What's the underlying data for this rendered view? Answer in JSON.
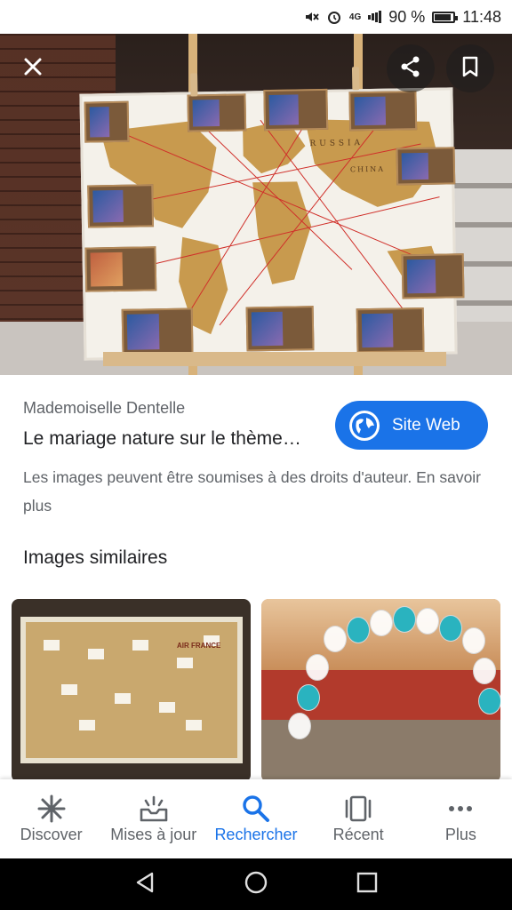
{
  "status_bar": {
    "network": "4G",
    "battery": "90 %",
    "time": "11:48"
  },
  "hero": {
    "icons": [
      "close-icon",
      "share-icon",
      "bookmark-icon"
    ],
    "map_labels": [
      "RUSSIA",
      "CHINA"
    ]
  },
  "result": {
    "source": "Mademoiselle Dentelle",
    "title": "Le mariage nature sur le thème…",
    "site_button": "Site Web",
    "copyright": "Les images peuvent être soumises à des droits d'auteur. En savoir plus"
  },
  "similar": {
    "heading": "Images similaires",
    "thumb1_label": "AIR FRANCE"
  },
  "bottom_nav": {
    "items": [
      {
        "label": "Discover",
        "icon": "asterisk-icon"
      },
      {
        "label": "Mises à jour",
        "icon": "updates-icon"
      },
      {
        "label": "Rechercher",
        "icon": "search-icon"
      },
      {
        "label": "Récent",
        "icon": "recent-icon"
      },
      {
        "label": "Plus",
        "icon": "more-icon"
      }
    ],
    "active": "Rechercher"
  },
  "colors": {
    "accent": "#1a73e8",
    "text_primary": "#202124",
    "text_secondary": "#5f6368"
  }
}
